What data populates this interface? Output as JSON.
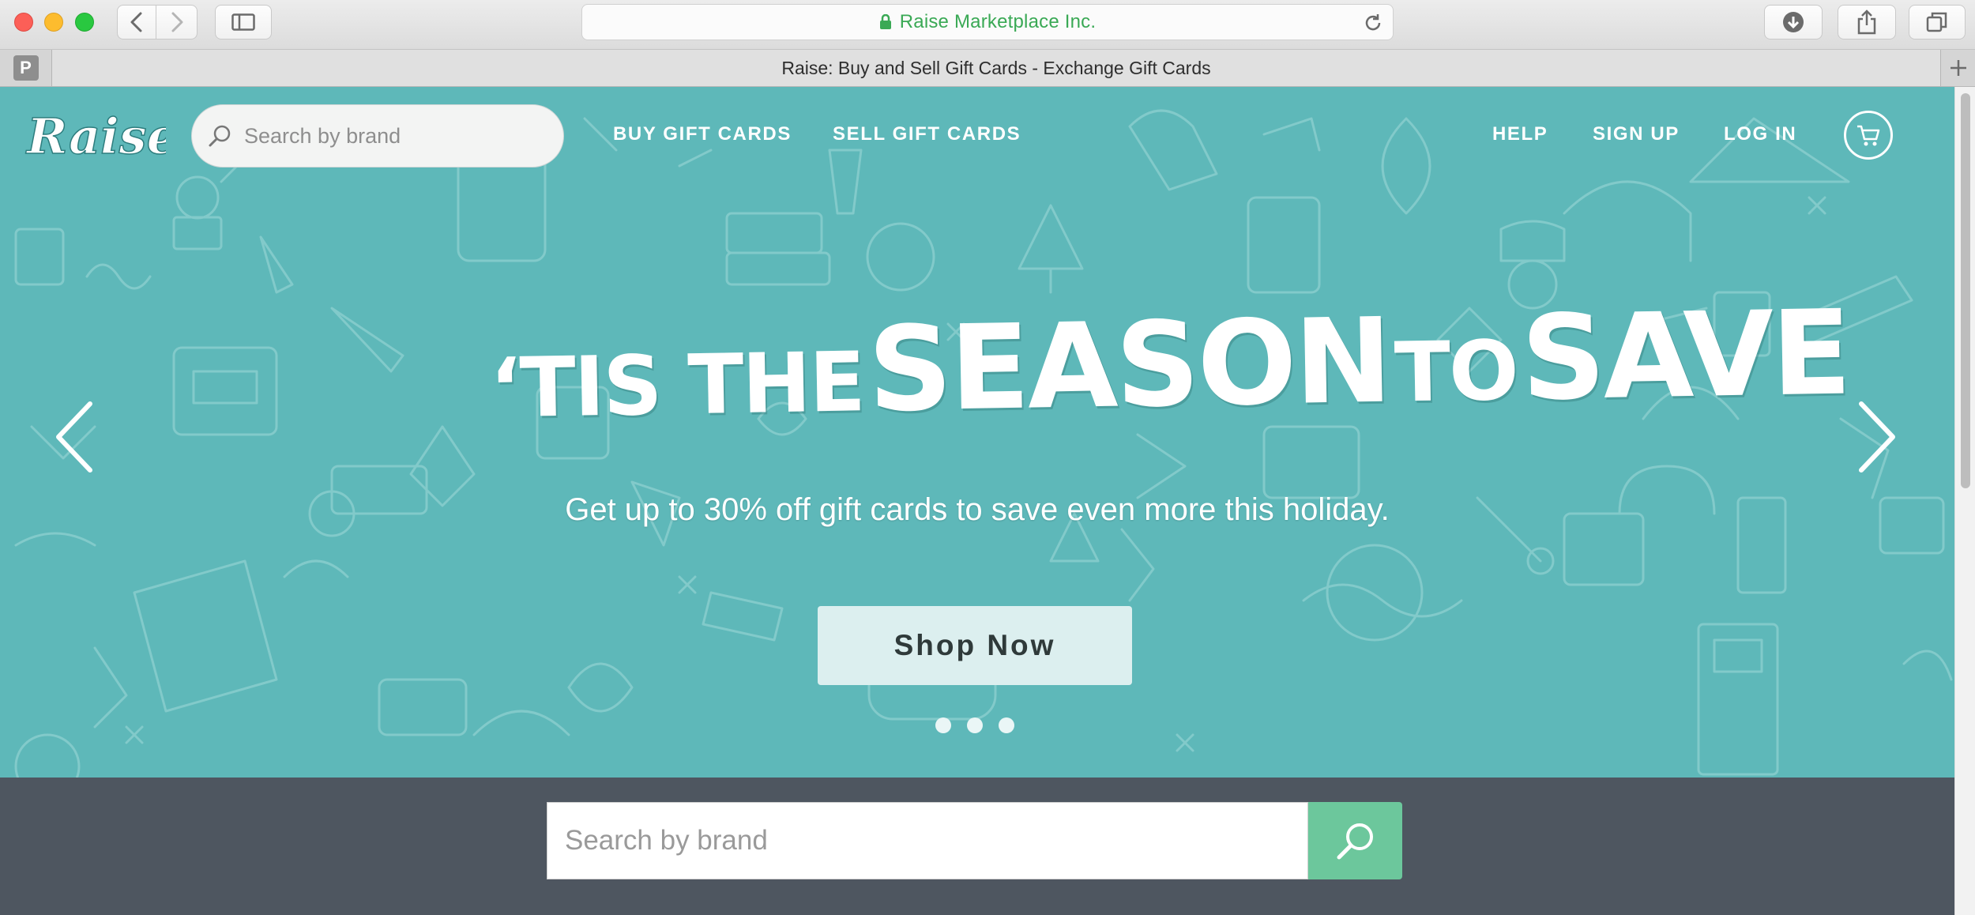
{
  "browser": {
    "address": "Raise Marketplace Inc.",
    "tab_title": "Raise: Buy and Sell Gift Cards - Exchange Gift Cards",
    "pinned_tab_letter": "P",
    "secure_color": "#3aa955"
  },
  "header": {
    "logo_text": "Raise",
    "search_placeholder": "Search by brand",
    "nav_left": [
      "BUY GIFT CARDS",
      "SELL GIFT CARDS"
    ],
    "nav_right": [
      "HELP",
      "SIGN UP",
      "LOG IN"
    ]
  },
  "hero": {
    "headline_parts": [
      "‘TIS THE",
      "SEASON",
      "TO",
      "SAVE"
    ],
    "subhead": "Get up to 30% off gift cards to save even more this holiday.",
    "cta_label": "Shop Now",
    "slides_total": 3,
    "background_color": "#5eb8b9"
  },
  "brand_search": {
    "placeholder": "Search by brand",
    "button_color": "#6cc79c",
    "band_color": "#4e5660"
  }
}
